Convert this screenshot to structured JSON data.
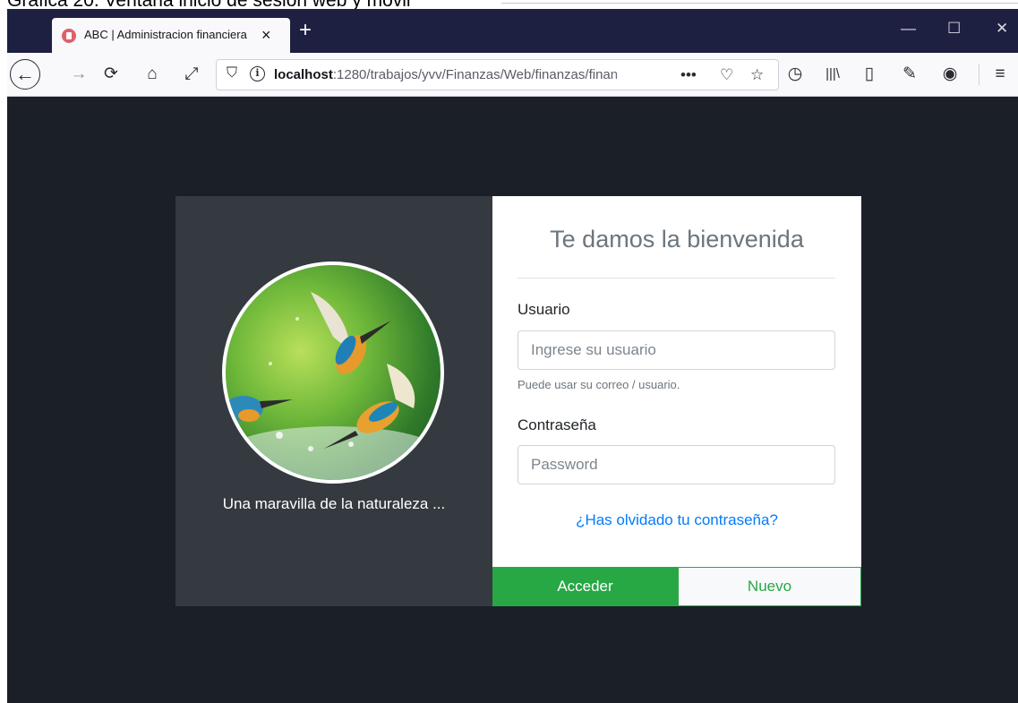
{
  "document": {
    "caption": "Gráfica 20. Ventana inicio de sesión web y móvil"
  },
  "browser": {
    "tab_title": "ABC | Administracion financiera",
    "url_host": "localhost",
    "url_path": ":1280/trabajos/yvv/Finanzas/Web/finanzas/finan",
    "icons": {
      "tab_close": "×",
      "new_tab": "+",
      "minimize": "—",
      "maximize": "☐",
      "close": "✕",
      "back": "←",
      "forward": "→",
      "reload": "⟳",
      "home": "⌂",
      "fullscreen": "⤢",
      "shield": "⛉",
      "info": "i",
      "more": "•••",
      "pocket": "♡",
      "bookmark": "☆",
      "history": "◷",
      "library": "|||\\",
      "sidebar": "▯",
      "eyedropper": "✎",
      "account": "◉",
      "menu": "≡"
    }
  },
  "login": {
    "image_caption": "Una maravilla de la naturaleza ...",
    "title": "Te damos la bienvenida",
    "user_label": "Usuario",
    "user_placeholder": "Ingrese su usuario",
    "user_help": "Puede usar su correo / usuario.",
    "password_label": "Contraseña",
    "password_placeholder": "Password",
    "forgot_link": "¿Has olvidado tu contraseña?",
    "login_button": "Acceder",
    "new_button": "Nuevo"
  },
  "colors": {
    "page_bg": "#1b1f27",
    "panel_dark": "#343a40",
    "primary_green": "#28a745",
    "link_blue": "#007bff",
    "browser_titlebar": "#1e2042"
  }
}
